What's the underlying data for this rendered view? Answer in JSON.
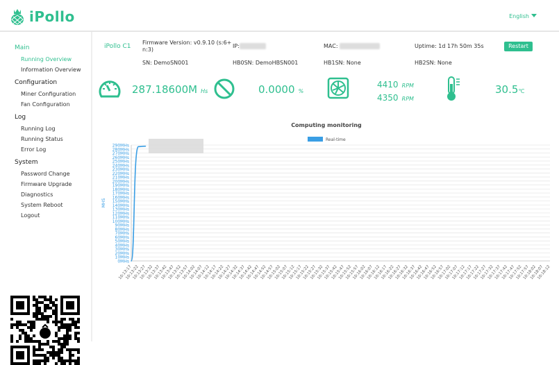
{
  "header": {
    "logo": "iPollo",
    "language": "English"
  },
  "sidebar": [
    {
      "label": "Main",
      "active": true,
      "items": [
        {
          "label": "Running Overview",
          "active": true
        },
        {
          "label": "Information Overview"
        }
      ]
    },
    {
      "label": "Configuration",
      "items": [
        {
          "label": "Miner Configuration"
        },
        {
          "label": "Fan Configuration"
        }
      ]
    },
    {
      "label": "Log",
      "items": [
        {
          "label": "Running Log"
        },
        {
          "label": "Running Status"
        },
        {
          "label": "Error Log"
        }
      ]
    },
    {
      "label": "System",
      "items": [
        {
          "label": "Password Change"
        },
        {
          "label": "Firmware Upgrade"
        },
        {
          "label": "Diagnostics"
        },
        {
          "label": "System Reboot"
        },
        {
          "label": "Logout"
        }
      ]
    }
  ],
  "device": {
    "name": "iPollo C1",
    "firmware": "Firmware Version: v0.9.10 (s:6+ n:3)",
    "ip_label": "IP:",
    "mac_label": "MAC: ",
    "uptime": "Uptime: 1d 17h 50m 35s",
    "restart": "Restart",
    "sn": "SN: DemoSN001",
    "hb0sn": "HB0SN: DemoHBSN001",
    "hb1sn": "HB1SN: None",
    "hb2sn": "HB2SN: None"
  },
  "stats": {
    "hashrate": "287.18600M",
    "hashrate_unit": "Hs",
    "reject": "0.0000",
    "reject_unit": "%",
    "fan1": "4410",
    "fan2": "4350",
    "fan_unit": "RPM",
    "temp": "30.5",
    "temp_unit": "℃"
  },
  "colors": {
    "accent": "#2fbf8f",
    "series": "#3a9ee4"
  },
  "chart_data": {
    "type": "line",
    "title": "Computing monitoring",
    "ylabel": "MHS",
    "legend": "Real-time",
    "legend_position": "top",
    "grid": true,
    "ylim": [
      0,
      290
    ],
    "ytick_step": 10,
    "ytick_suffix": "MHs",
    "x_start": "10:13:17",
    "x_end": "10:18:12",
    "x_step_seconds": 5,
    "series": [
      {
        "name": "Real-time",
        "values": [
          0,
          286,
          287
        ]
      }
    ]
  }
}
